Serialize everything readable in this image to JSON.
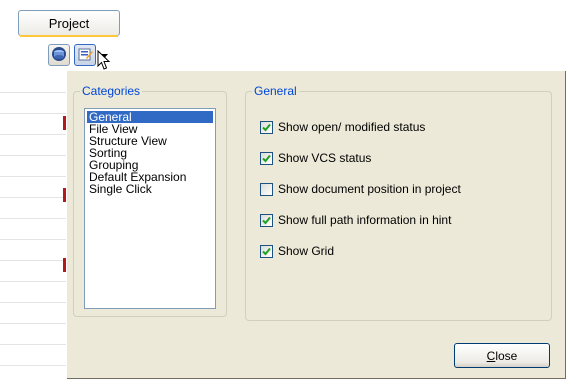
{
  "toolbar": {
    "project_tab_label": "Project",
    "buttons": [
      {
        "icon": "database-icon"
      },
      {
        "icon": "options-icon"
      }
    ],
    "dropdown_icon": "chevron-down-icon"
  },
  "popup": {
    "categories": {
      "group_title": "Categories",
      "items": [
        "General",
        "File View",
        "Structure View",
        "Sorting",
        "Grouping",
        "Default Expansion",
        "Single Click"
      ],
      "selected_index": 0
    },
    "general": {
      "group_title": "General",
      "options": [
        {
          "label": "Show open/ modified status",
          "checked": true
        },
        {
          "label": "Show VCS status",
          "checked": true
        },
        {
          "label": "Show document position in project",
          "checked": false
        },
        {
          "label": "Show full path information in hint",
          "checked": true
        },
        {
          "label": "Show Grid",
          "checked": true
        }
      ]
    },
    "close_button": {
      "mnemonic": "C",
      "rest": "lose"
    }
  },
  "colors": {
    "group_title": "#0046d5",
    "selection": "#316ac5",
    "checkmark": "#21a121",
    "dialog_bg": "#ece9d8"
  }
}
